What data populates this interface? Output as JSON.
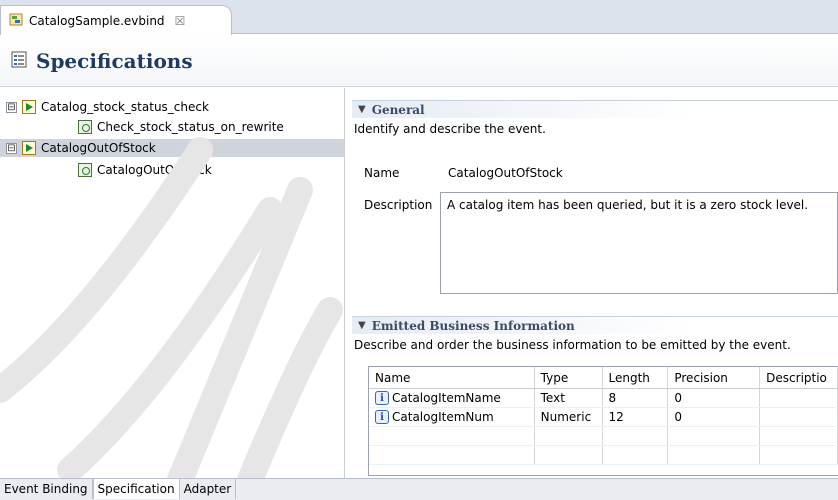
{
  "editor_tab": {
    "label": "CatalogSample.evbind",
    "close": "☒"
  },
  "page_title": "Specifications",
  "tree": [
    {
      "label": "Catalog_stock_status_check",
      "kind": "event",
      "expander": "⊟",
      "selected": false
    },
    {
      "label": "Check_stock_status_on_rewrite",
      "kind": "rule"
    },
    {
      "label": "CatalogOutOfStock",
      "kind": "event",
      "expander": "⊟",
      "selected": true
    },
    {
      "label": "CatalogOutOfStock",
      "kind": "rule"
    }
  ],
  "general": {
    "title": "General",
    "description": "Identify and describe the event.",
    "name_label": "Name",
    "name_value": "CatalogOutOfStock",
    "description_label": "Description",
    "description_value": "A catalog item has been queried, but it is a zero stock level."
  },
  "emitted": {
    "title": "Emitted Business Information",
    "description": "Describe and order the business information to be emitted by the event.",
    "columns": [
      "Name",
      "Type",
      "Length",
      "Precision",
      "Descriptio"
    ],
    "rows": [
      {
        "name": "CatalogItemName",
        "type": "Text",
        "length": "8",
        "precision": "0"
      },
      {
        "name": "CatalogItemNum",
        "type": "Numeric",
        "length": "12",
        "precision": "0"
      }
    ],
    "info_icon": "i"
  },
  "bottom_tabs": [
    "Event Binding",
    "Specification",
    "Adapter"
  ],
  "icons": {
    "tab": "evbind-file-icon",
    "header": "specifications-icon",
    "event": "event-icon",
    "rule": "rule-icon",
    "field": "info-icon"
  },
  "colors": {
    "title": "#1f3a64",
    "selection": "#cfd3dc",
    "section_head": "#3a4a63"
  }
}
